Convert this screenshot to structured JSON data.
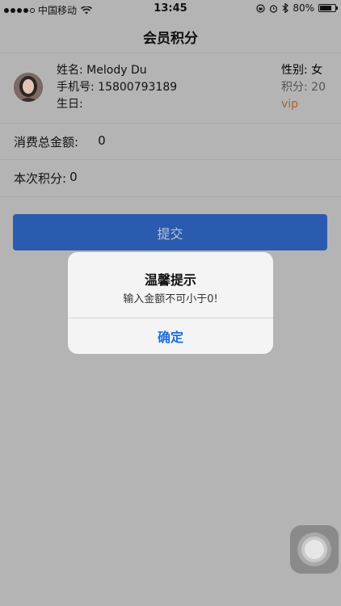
{
  "status_bar": {
    "carrier": "中国移动",
    "time": "13:45",
    "battery": "80%"
  },
  "nav": {
    "title": "会员积分"
  },
  "member": {
    "name_label": "姓名:",
    "name": "Melody Du",
    "phone_label": "手机号:",
    "phone": "15800793189",
    "birthday_label": "生日:",
    "birthday": "",
    "gender_label": "性别:",
    "gender": "女",
    "points_label": "积分:",
    "points": "20",
    "level": "vip"
  },
  "form": {
    "total_label": "消费总金额:",
    "total_value": "0",
    "points_label": "本次积分:",
    "points_value": "0",
    "submit_label": "提交"
  },
  "alert": {
    "title": "温馨提示",
    "message": "输入金额不可小于0!",
    "confirm_label": "确定"
  },
  "colors": {
    "overlay_bg": "#b4b4b4",
    "submit_bg": "#2b5bae",
    "alert_button": "#1b6fd8",
    "vip": "#a9622a"
  }
}
